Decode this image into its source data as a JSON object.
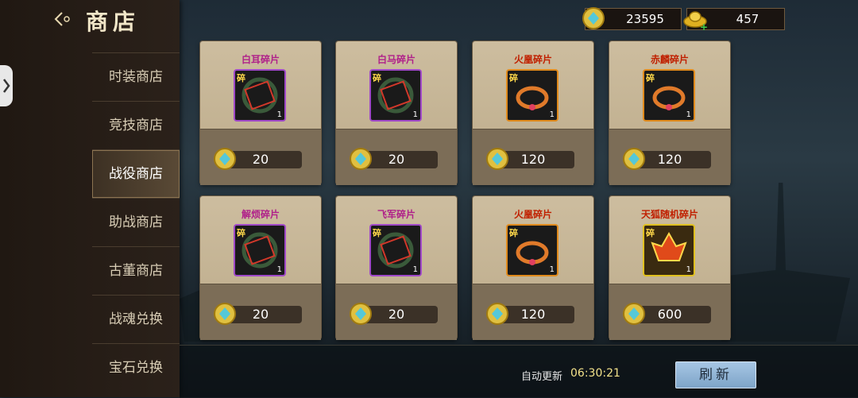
{
  "header": {
    "title": "商店"
  },
  "currencies": [
    {
      "name": "silver-coin-icon",
      "value": "23595"
    },
    {
      "name": "gold-ingot-icon",
      "value": "457"
    }
  ],
  "menu": [
    {
      "label": "时装商店",
      "active": false
    },
    {
      "label": "竞技商店",
      "active": false
    },
    {
      "label": "战役商店",
      "active": true
    },
    {
      "label": "助战商店",
      "active": false
    },
    {
      "label": "古董商店",
      "active": false
    },
    {
      "label": "战魂兑换",
      "active": false
    },
    {
      "label": "宝石兑换",
      "active": false
    }
  ],
  "items": [
    {
      "name": "白耳碎片",
      "color": "#b0208a",
      "frame": "purple",
      "tag": "碎",
      "qty": "1",
      "price": "20"
    },
    {
      "name": "白马碎片",
      "color": "#b0208a",
      "frame": "purple",
      "tag": "碎",
      "qty": "1",
      "price": "20"
    },
    {
      "name": "火凰碎片",
      "color": "#c02000",
      "frame": "orange",
      "tag": "碎",
      "qty": "1",
      "price": "120"
    },
    {
      "name": "赤麟碎片",
      "color": "#c02000",
      "frame": "orange",
      "tag": "碎",
      "qty": "1",
      "price": "120"
    },
    {
      "name": "解烦碎片",
      "color": "#b0208a",
      "frame": "purple",
      "tag": "碎",
      "qty": "1",
      "price": "20"
    },
    {
      "name": "飞军碎片",
      "color": "#b0208a",
      "frame": "purple",
      "tag": "碎",
      "qty": "1",
      "price": "20"
    },
    {
      "name": "火凰碎片",
      "color": "#c02000",
      "frame": "orange",
      "tag": "碎",
      "qty": "1",
      "price": "120"
    },
    {
      "name": "天狐随机碎片",
      "color": "#c02000",
      "frame": "gold",
      "tag": "碎",
      "qty": "1",
      "price": "600"
    }
  ],
  "footer": {
    "auto_refresh_label": "自动更新",
    "timer": "06:30:21",
    "refresh_label": "刷新"
  }
}
